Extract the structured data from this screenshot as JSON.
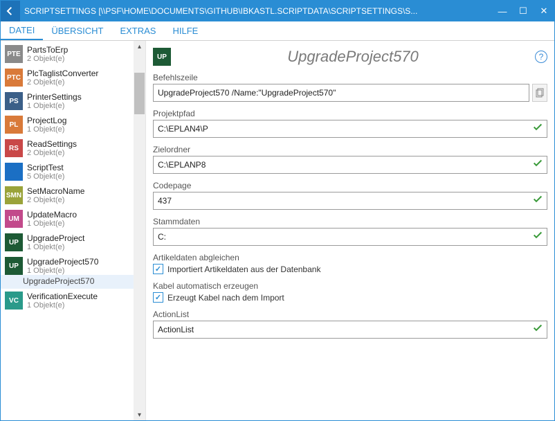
{
  "window": {
    "title": "SCRIPTSETTINGS [\\\\PSF\\HOME\\DOCUMENTS\\GITHUB\\IBKASTL.SCRIPTDATA\\SCRIPTSETTINGS\\S..."
  },
  "menu": {
    "items": [
      "DATEI",
      "ÜBERSICHT",
      "EXTRAS",
      "HILFE"
    ],
    "active_index": 0
  },
  "sidebar": {
    "items": [
      {
        "abbr": "PTE",
        "color": "gray",
        "name": "PartsToErp",
        "sub": "2 Objekt(e)"
      },
      {
        "abbr": "PTC",
        "color": "orange",
        "name": "PlcTaglistConverter",
        "sub": "2 Objekt(e)"
      },
      {
        "abbr": "PS",
        "color": "navy",
        "name": "PrinterSettings",
        "sub": "1 Objekt(e)"
      },
      {
        "abbr": "PL",
        "color": "orange",
        "name": "ProjectLog",
        "sub": "1 Objekt(e)"
      },
      {
        "abbr": "RS",
        "color": "red",
        "name": "ReadSettings",
        "sub": "2 Objekt(e)"
      },
      {
        "abbr": "",
        "color": "blue",
        "name": "ScriptTest",
        "sub": "5 Objekt(e)"
      },
      {
        "abbr": "SMN",
        "color": "olive",
        "name": "SetMacroName",
        "sub": "2 Objekt(e)"
      },
      {
        "abbr": "UM",
        "color": "pink",
        "name": "UpdateMacro",
        "sub": "1 Objekt(e)"
      },
      {
        "abbr": "UP",
        "color": "darkgreen",
        "name": "UpgradeProject",
        "sub": "1 Objekt(e)"
      },
      {
        "abbr": "UP",
        "color": "darkgreen2",
        "name": "UpgradeProject570",
        "sub": "1 Objekt(e)"
      },
      {
        "abbr": "VC",
        "color": "teal",
        "name": "VerificationExecute",
        "sub": "1 Objekt(e)"
      }
    ],
    "selected_index": 9,
    "selected_child": "UpgradeProject570"
  },
  "main": {
    "title": "UpgradeProject570",
    "icon_abbr": "UP",
    "fields": {
      "befehlszeile": {
        "label": "Befehlszeile",
        "value": "UpgradeProject570 /Name:\"UpgradeProject570\""
      },
      "projektpfad": {
        "label": "Projektpfad",
        "value": "C:\\EPLAN4\\P"
      },
      "zielordner": {
        "label": "Zielordner",
        "value": "C:\\EPLANP8"
      },
      "codepage": {
        "label": "Codepage",
        "value": "437"
      },
      "stammdaten": {
        "label": "Stammdaten",
        "value": "C:"
      },
      "artikeldaten": {
        "label": "Artikeldaten abgleichen",
        "check_label": "Importiert Artikeldaten aus der Datenbank",
        "checked": true
      },
      "kabel": {
        "label": "Kabel automatisch erzeugen",
        "check_label": "Erzeugt Kabel nach dem Import",
        "checked": true
      },
      "actionlist": {
        "label": "ActionList",
        "value": "ActionList"
      }
    }
  }
}
